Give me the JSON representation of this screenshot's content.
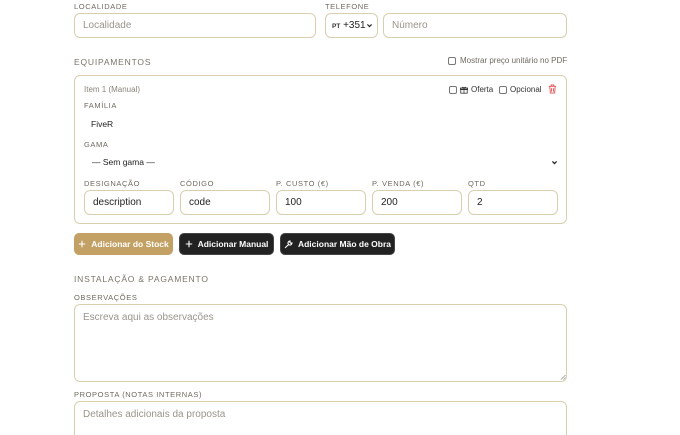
{
  "contact": {
    "locality_label": "LOCALIDADE",
    "locality_placeholder": "Localidade",
    "phone_label": "TELEFONE",
    "country_flag": "PT",
    "country_code": "+351",
    "phone_placeholder": "Número"
  },
  "equipment": {
    "section_title": "EQUIPAMENTOS",
    "show_unit_price_label": "Mostrar preço unitário no PDF",
    "item": {
      "title": "Item 1 (Manual)",
      "offer_label": "Oferta",
      "optional_label": "Opcional",
      "family_label": "FAMÍLIA",
      "family_value": "FiveR",
      "range_label": "GAMA",
      "range_value": "— Sem gama —",
      "designation_label": "DESIGNAÇÃO",
      "designation_value": "description",
      "code_label": "CÓDIGO",
      "code_value": "code",
      "cost_label": "P. CUSTO (€)",
      "cost_value": "100",
      "sale_label": "P. VENDA (€)",
      "sale_value": "200",
      "qty_label": "QTD",
      "qty_value": "2"
    },
    "buttons": {
      "add_stock": "Adicionar do Stock",
      "add_manual": "Adicionar Manual",
      "add_labor": "Adicionar Mão de Obra"
    }
  },
  "installation": {
    "section_title": "INSTALAÇÃO & PAGAMENTO",
    "notes_label": "OBSERVAÇÕES",
    "notes_placeholder": "Escreva aqui as observações",
    "proposal_label": "PROPOSTA (NOTAS INTERNAS)",
    "proposal_placeholder": "Detalhes adicionais da proposta"
  },
  "colors": {
    "accent": "#c3a164",
    "border": "#d9cfae",
    "danger": "#e05252",
    "dark_button": "#222222"
  }
}
